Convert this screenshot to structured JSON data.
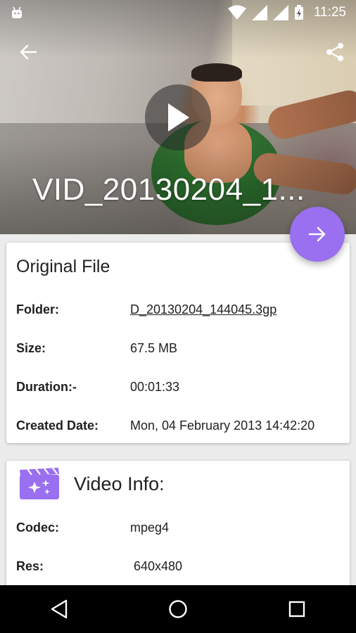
{
  "status_bar": {
    "time": "11:25"
  },
  "hero": {
    "title": "VID_20130204_1..."
  },
  "original_file": {
    "title": "Original File",
    "rows": [
      {
        "label": "Folder:",
        "value": "D_20130204_144045.3gp"
      },
      {
        "label": "Size:",
        "value": "67.5 MB"
      },
      {
        "label": "Duration:-",
        "value": "00:01:33"
      },
      {
        "label": "Created Date:",
        "value": "Mon, 04 February 2013 14:42:20"
      }
    ]
  },
  "video_info": {
    "title": "Video Info:",
    "rows": [
      {
        "label": "Codec:",
        "value": "mpeg4"
      },
      {
        "label": "Res:",
        "value": "640x480"
      }
    ]
  },
  "colors": {
    "accent": "#9a6ff0",
    "icon_purple": "#9a6ff0"
  },
  "icons": [
    "android-icon",
    "wifi-icon",
    "signal-icon",
    "battery-icon",
    "back-arrow-icon",
    "share-icon",
    "play-icon",
    "arrow-right-icon",
    "video-magic-icon",
    "nav-back-icon",
    "nav-home-icon",
    "nav-recents-icon"
  ]
}
